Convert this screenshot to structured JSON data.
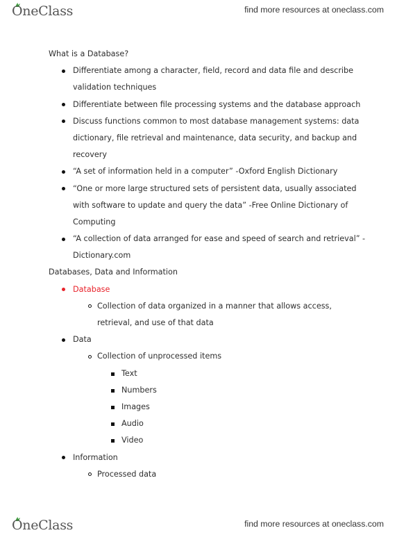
{
  "header": {
    "logo_text": "OneClass",
    "link_text": "find more resources at oneclass.com"
  },
  "footer": {
    "logo_text": "OneClass",
    "link_text": "find more resources at oneclass.com"
  },
  "colors": {
    "highlight": "#e8232b",
    "logo_leaf": "#3a9a3a"
  },
  "document": {
    "section1": {
      "heading": "What is a Database?",
      "items": [
        {
          "lines": [
            "Differentiate among a character, field, record and data file and describe",
            "validation techniques"
          ]
        },
        {
          "lines": [
            "Differentiate between file processing systems and the database approach"
          ]
        },
        {
          "lines": [
            "Discuss functions common to most database management systems: data",
            "dictionary, file retrieval and maintenance, data security, and backup and",
            "recovery"
          ]
        },
        {
          "lines": [
            "“A set of information held in a computer” -Oxford English Dictionary"
          ]
        },
        {
          "lines": [
            "“One or more large structured sets of persistent data, usually associated",
            "with software to update and query the data” -Free Online Dictionary of",
            "Computing"
          ]
        },
        {
          "lines": [
            "“A collection of data arranged for ease and speed of search and retrieval” -",
            "Dictionary.com"
          ]
        }
      ]
    },
    "section2": {
      "heading": "Databases, Data and Information",
      "database": {
        "label": "Database",
        "sub": [
          "Collection of data organized in a manner that allows access,",
          "retrieval, and use of that data"
        ]
      },
      "data": {
        "label": "Data",
        "sub": "Collection of unprocessed items",
        "items": [
          "Text",
          "Numbers",
          "Images",
          "Audio",
          "Video"
        ]
      },
      "information": {
        "label": "Information",
        "sub": "Processed data"
      }
    }
  }
}
